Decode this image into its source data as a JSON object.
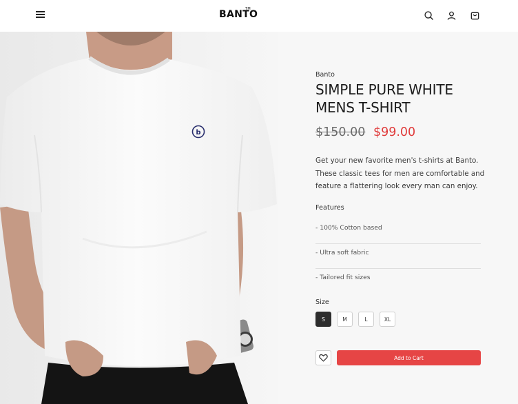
{
  "header": {
    "logo": "BANTO",
    "logo_mark": "TM",
    "icons": [
      "menu-icon",
      "search-icon",
      "user-icon",
      "cart-icon"
    ]
  },
  "product": {
    "brand": "Banto",
    "title": "SIMPLE PURE WHITE MENS T-SHIRT",
    "old_price": "$150.00",
    "price": "$99.00",
    "description": "Get your new favorite men's t-shirts at Banto. These classic tees for men are comfortable and feature a flattering look every man can enjoy.",
    "features_label": "Features",
    "features": [
      "- 100% Cotton based",
      "- Ultra soft fabric",
      "- Tailored fit sizes"
    ],
    "size_label": "Size",
    "sizes": [
      "S",
      "M",
      "L",
      "XL"
    ],
    "selected_size": "S",
    "add_to_cart": "Add to Cart",
    "shirt_logo": "b"
  },
  "colors": {
    "accent": "#e64545",
    "sale_price": "#e03b3b",
    "selected_size_bg": "#2d2d2d"
  }
}
